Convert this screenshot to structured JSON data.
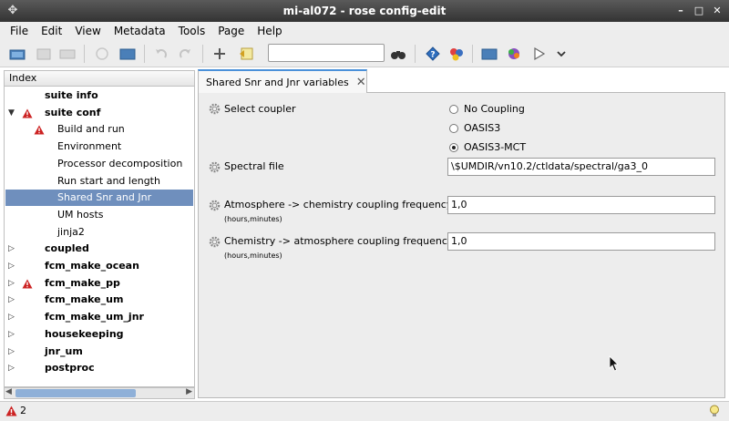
{
  "window": {
    "title": "mi-al072 - rose config-edit"
  },
  "menu": [
    "File",
    "Edit",
    "View",
    "Metadata",
    "Tools",
    "Page",
    "Help"
  ],
  "toolbar": {
    "search": {
      "value": "",
      "placeholder": ""
    },
    "icons": [
      "open-folder-icon",
      "save-icon",
      "save-all-icon",
      "stop-icon",
      "folder-icon",
      "undo-icon",
      "redo-icon",
      "add-icon",
      "revert-icon",
      "binoculars-icon",
      "help-icon",
      "macro-icon",
      "graph-folder-icon",
      "transform-icon",
      "run-icon",
      "chevron-down-icon"
    ]
  },
  "index": {
    "header": "Index",
    "items": [
      {
        "label": "suite info",
        "bold": true,
        "level": 0,
        "expander": "",
        "warn": false
      },
      {
        "label": "suite conf",
        "bold": true,
        "level": 0,
        "expander": "expanded",
        "warn": true
      },
      {
        "label": "Build and run",
        "bold": false,
        "level": 1,
        "expander": "",
        "warn": true
      },
      {
        "label": "Environment",
        "bold": false,
        "level": 1,
        "expander": "",
        "warn": false
      },
      {
        "label": "Processor decomposition",
        "bold": false,
        "level": 1,
        "expander": "",
        "warn": false
      },
      {
        "label": "Run start and length",
        "bold": false,
        "level": 1,
        "expander": "",
        "warn": false
      },
      {
        "label": "Shared Snr and Jnr variables",
        "bold": false,
        "level": 1,
        "expander": "",
        "warn": false,
        "selected": true
      },
      {
        "label": "UM hosts",
        "bold": false,
        "level": 1,
        "expander": "",
        "warn": false
      },
      {
        "label": "jinja2",
        "bold": false,
        "level": 1,
        "expander": "",
        "warn": false
      },
      {
        "label": "coupled",
        "bold": true,
        "level": 0,
        "expander": "collapsed",
        "warn": false
      },
      {
        "label": "fcm_make_ocean",
        "bold": true,
        "level": 0,
        "expander": "collapsed",
        "warn": false
      },
      {
        "label": "fcm_make_pp",
        "bold": true,
        "level": 0,
        "expander": "collapsed",
        "warn": true
      },
      {
        "label": "fcm_make_um",
        "bold": true,
        "level": 0,
        "expander": "collapsed",
        "warn": false
      },
      {
        "label": "fcm_make_um_jnr",
        "bold": true,
        "level": 0,
        "expander": "collapsed",
        "warn": false
      },
      {
        "label": "housekeeping",
        "bold": true,
        "level": 0,
        "expander": "collapsed",
        "warn": false
      },
      {
        "label": "jnr_um",
        "bold": true,
        "level": 0,
        "expander": "collapsed",
        "warn": false
      },
      {
        "label": "postproc",
        "bold": true,
        "level": 0,
        "expander": "collapsed",
        "warn": false
      }
    ]
  },
  "tab": {
    "label": "Shared Snr and Jnr variables"
  },
  "panel": {
    "select_coupler": {
      "label": "Select coupler",
      "options": [
        "No Coupling",
        "OASIS3",
        "OASIS3-MCT"
      ],
      "selected": "OASIS3-MCT"
    },
    "spectral_file": {
      "label": "Spectral file",
      "value": "\\$UMDIR/vn10.2/ctldata/spectral/ga3_0"
    },
    "atm_chem": {
      "label": "Atmosphere -> chemistry coupling frequency",
      "sub": "(hours,minutes)",
      "value": "1,0"
    },
    "chem_atm": {
      "label": "Chemistry -> atmosphere coupling frequency",
      "sub": "(hours,minutes)",
      "value": "1,0"
    }
  },
  "status": {
    "warning_count": "2"
  },
  "colors": {
    "selection": "#6f8fbd",
    "tab_accent": "#4a90d9",
    "warning": "#cc2222"
  }
}
